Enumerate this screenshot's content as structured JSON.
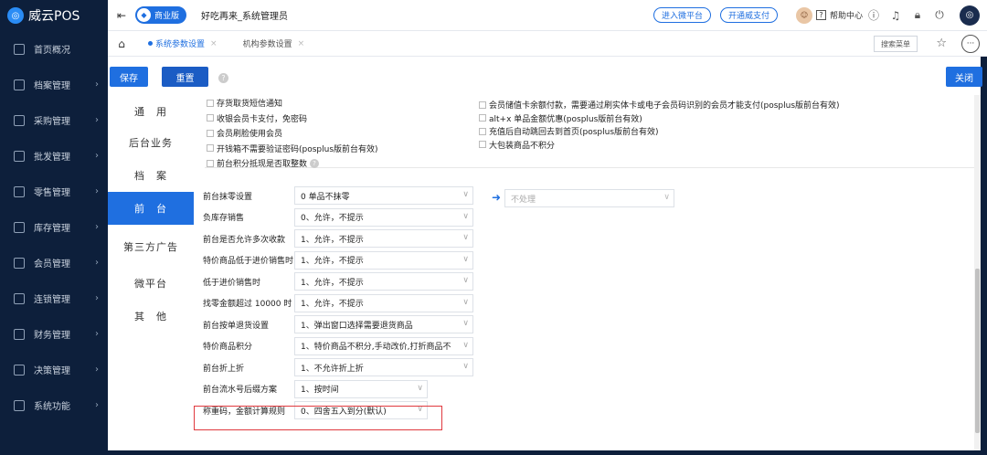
{
  "app": {
    "logo_text": "威云POS",
    "edition": "商业版",
    "store": "好吃再来_系统管理员"
  },
  "topbar": {
    "link_micro": "进入微平台",
    "link_pay": "开通威支付",
    "help": "帮助中心"
  },
  "sidebar": {
    "items": [
      {
        "label": "首页概况",
        "icon": "home-icon"
      },
      {
        "label": "档案管理",
        "icon": "archive-icon"
      },
      {
        "label": "采购管理",
        "icon": "purchase-icon"
      },
      {
        "label": "批发管理",
        "icon": "wholesale-icon"
      },
      {
        "label": "零售管理",
        "icon": "retail-icon"
      },
      {
        "label": "库存管理",
        "icon": "inventory-icon"
      },
      {
        "label": "会员管理",
        "icon": "member-icon"
      },
      {
        "label": "连锁管理",
        "icon": "chain-icon"
      },
      {
        "label": "财务管理",
        "icon": "finance-icon"
      },
      {
        "label": "决策管理",
        "icon": "decision-icon"
      },
      {
        "label": "系统功能",
        "icon": "system-icon"
      }
    ]
  },
  "tabs": [
    {
      "label": "系统参数设置",
      "active": true
    },
    {
      "label": "机构参数设置",
      "active": false
    }
  ],
  "tabbar": {
    "search_menu": "搜索菜单"
  },
  "actions": {
    "save": "保存",
    "reset": "重置",
    "close": "关闭"
  },
  "categories": [
    "通　用",
    "后台业务",
    "档　案",
    "前　台",
    "第三方广告",
    "微平台",
    "其　他"
  ],
  "active_category": "前　台",
  "options_left": [
    "存货取货短信通知",
    "收银会员卡支付，免密码",
    "会员刷脸使用会员",
    "开钱箱不需要验证密码(posplus版前台有效)",
    "前台积分抵现是否取整数"
  ],
  "options_right": [
    "会员储值卡余额付款，需要通过刷实体卡或电子会员码识别的会员才能支付(posplus版前台有效)",
    "alt+x 单品金额优惠(posplus版前台有效)",
    "充值后自动跳回去到首页(posplus版前台有效)",
    "大包装商品不积分"
  ],
  "form": [
    {
      "label": "前台抹零设置",
      "value": "0 单品不抹零"
    },
    {
      "label": "负库存销售",
      "value": "0、允许，不提示"
    },
    {
      "label": "前台是否允许多次收款",
      "value": "1、允许，不提示"
    },
    {
      "label": "特价商品低于进价销售时",
      "value": "1、允许，不提示"
    },
    {
      "label": "低于进价销售时",
      "value": "1、允许，不提示"
    },
    {
      "label": "找零金额超过 10000 时",
      "value": "1、允许，不提示"
    },
    {
      "label": "前台按单退货设置",
      "value": "1、弹出窗口选择需要退货商品"
    },
    {
      "label": "特价商品积分",
      "value": "1、特价商品不积分,手动改价,打折商品不"
    },
    {
      "label": "前台折上折",
      "value": "1、不允许折上折"
    },
    {
      "label": "前台流水号后缀方案",
      "value": "1、按时间"
    },
    {
      "label": "称重码，金额计算规则",
      "value": "0、四舍五入到分(默认)"
    }
  ],
  "secondary_select": "不处理"
}
